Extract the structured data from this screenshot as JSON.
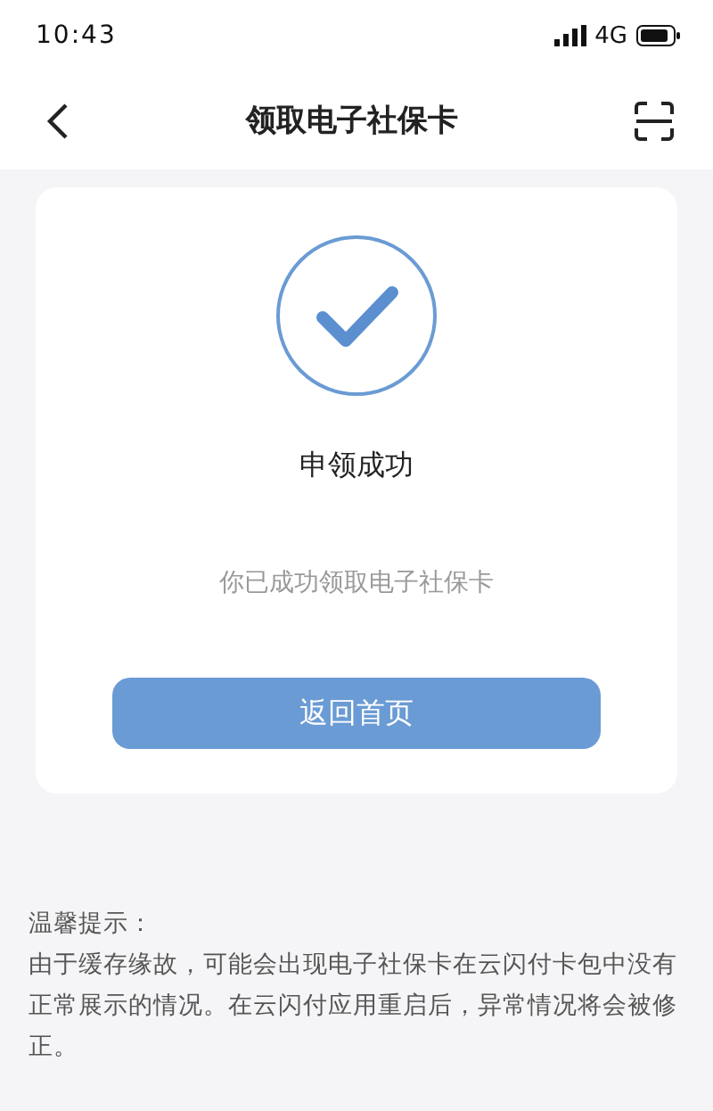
{
  "status_bar": {
    "time": "10:43",
    "network": "4G"
  },
  "nav": {
    "title": "领取电子社保卡"
  },
  "card": {
    "heading": "申领成功",
    "message": "你已成功领取电子社保卡",
    "button": "返回首页"
  },
  "tips": {
    "title": "温馨提示：",
    "body": "由于缓存缘故，可能会出现电子社保卡在云闪付卡包中没有正常展示的情况。在云闪付应用重启后，异常情况将会被修正。"
  }
}
